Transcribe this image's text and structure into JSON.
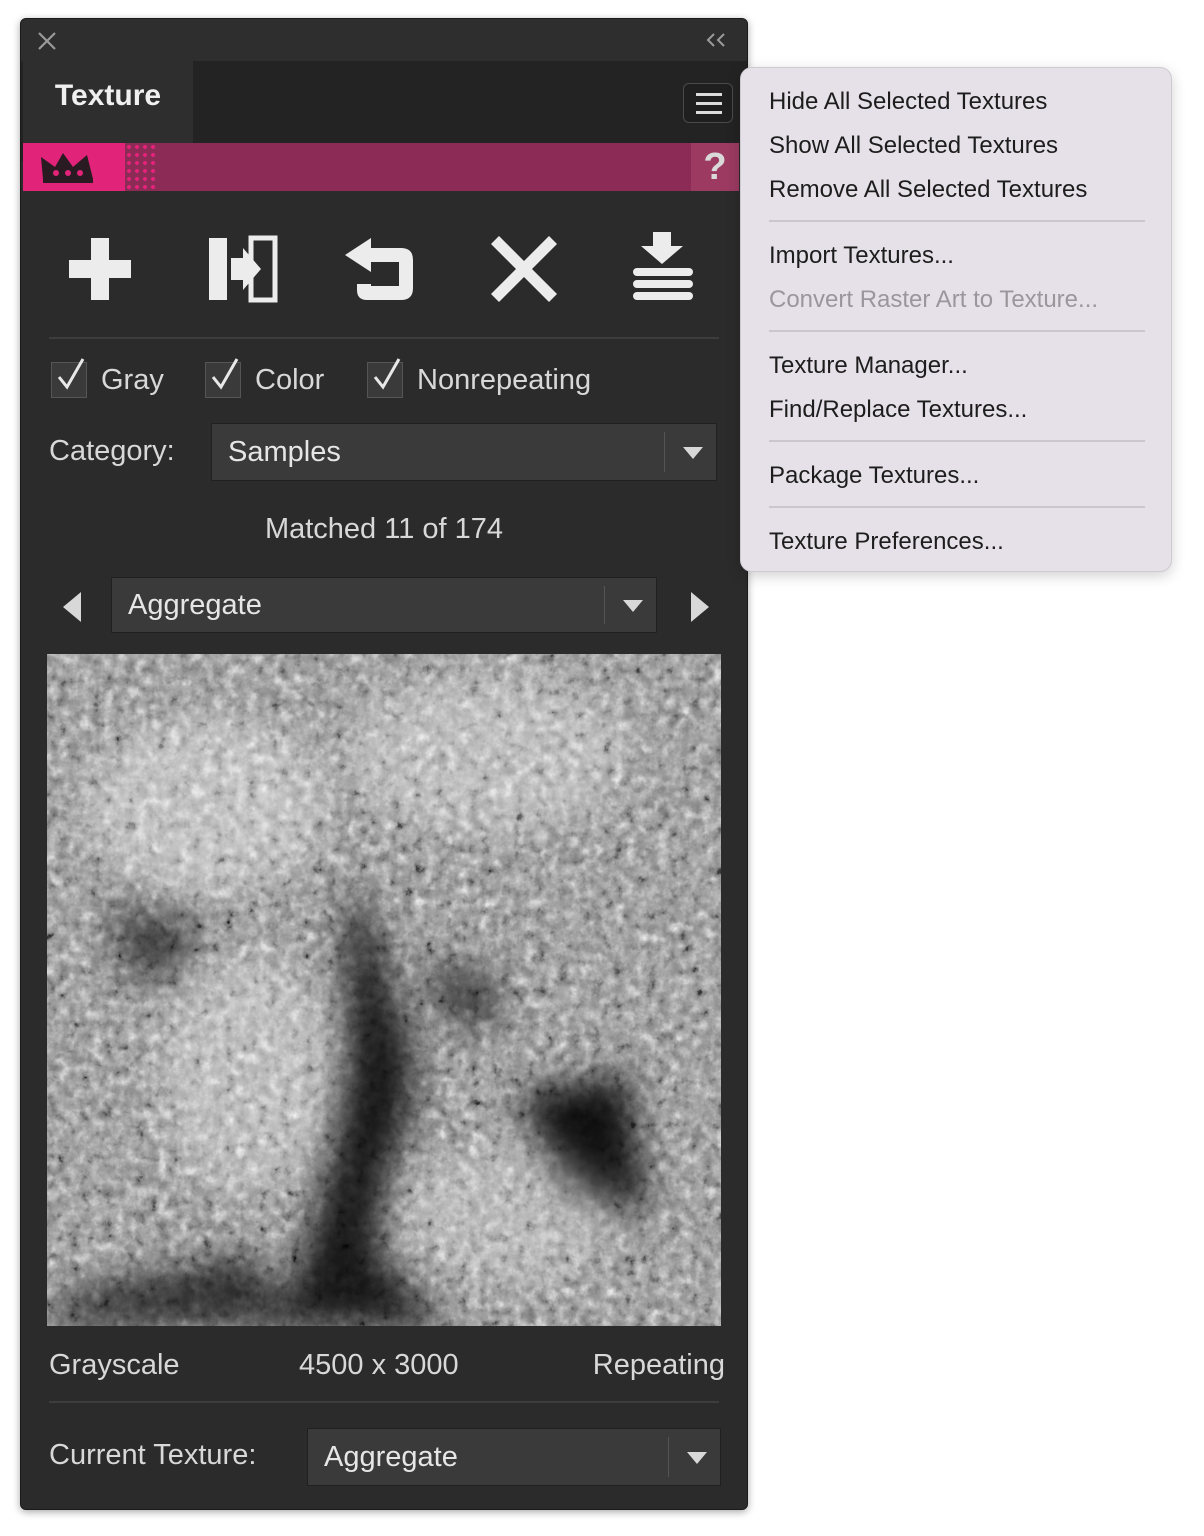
{
  "panel": {
    "tab_title": "Texture",
    "help_label": "?"
  },
  "filters": {
    "gray_label": "Gray",
    "gray_checked": true,
    "color_label": "Color",
    "color_checked": true,
    "nonrepeating_label": "Nonrepeating",
    "nonrepeating_checked": true
  },
  "category": {
    "label": "Category:",
    "value": "Samples"
  },
  "matched_text": "Matched 11 of 174",
  "browser": {
    "selected": "Aggregate"
  },
  "texture_info": {
    "mode": "Grayscale",
    "size": "4500 x 3000",
    "tiling": "Repeating"
  },
  "current_texture": {
    "label": "Current Texture:",
    "value": "Aggregate"
  },
  "context_menu": {
    "hide_all": "Hide All Selected Textures",
    "show_all": "Show All Selected Textures",
    "remove_all": "Remove All Selected Textures",
    "import": "Import Textures...",
    "convert": "Convert Raster Art to Texture...",
    "manager": "Texture Manager...",
    "find_replace": "Find/Replace Textures...",
    "package": "Package Textures...",
    "preferences": "Texture Preferences..."
  },
  "icons": {
    "close": "close-icon",
    "collapse": "collapse-icon",
    "menu": "hamburger-menu-icon",
    "crown": "crown-icon",
    "add": "plus-icon",
    "apply": "apply-texture-icon",
    "reset": "reset-icon",
    "delete": "x-delete-icon",
    "load": "load-library-icon"
  },
  "colors": {
    "panel_bg": "#2b2b2b",
    "brand_pink": "#e1237a",
    "brand_bar": "#8c2b55",
    "menu_bg": "#e6e1e8"
  }
}
